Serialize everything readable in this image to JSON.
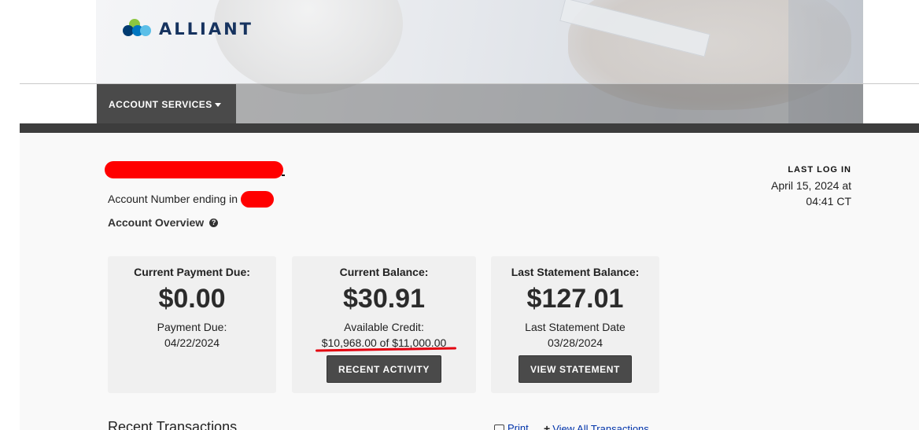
{
  "brand": {
    "name": "ALLIANT"
  },
  "nav": {
    "account_services": "ACCOUNT SERVICES"
  },
  "account": {
    "number_label": "Account Number ending in",
    "overview_label": "Account Overview"
  },
  "last_login": {
    "label": "LAST LOG IN",
    "value_line1": "April 15, 2024 at",
    "value_line2": "04:41 CT"
  },
  "cards": {
    "payment": {
      "title": "Current Payment Due:",
      "amount": "$0.00",
      "sub_label": "Payment Due:",
      "sub_value": "04/22/2024"
    },
    "balance": {
      "title": "Current Balance:",
      "amount": "$30.91",
      "sub_label": "Available Credit:",
      "sub_value": "$10,968.00 of $11,000.00",
      "button": "RECENT ACTIVITY"
    },
    "statement": {
      "title": "Last Statement Balance:",
      "amount": "$127.01",
      "sub_label": "Last Statement Date",
      "sub_value": "03/28/2024",
      "button": "VIEW STATEMENT"
    }
  },
  "transactions": {
    "title": "Recent Transactions",
    "print": "Print",
    "view_all": "View All Transactions"
  },
  "icons": {
    "help": "question-circle-icon",
    "print": "printer-icon",
    "view_all": "plus-icon",
    "nav_caret": "caret-down-icon"
  },
  "colors": {
    "nav_bg": "#4a4a4a",
    "brand_navy": "#16335f",
    "link": "#0033aa",
    "redaction": "#ff0000"
  }
}
